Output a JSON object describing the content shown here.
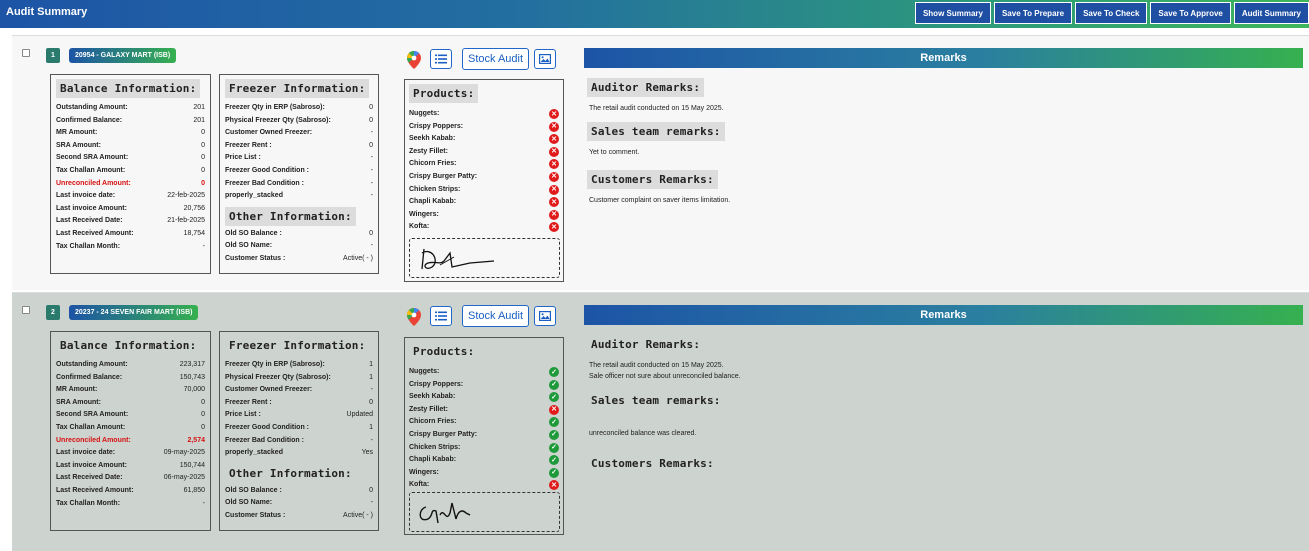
{
  "header": {
    "title": "Audit Summary",
    "buttons": [
      "Show Summary",
      "Save To Prepare",
      "Save To Check",
      "Save To Approve",
      "Audit Summary"
    ]
  },
  "labels": {
    "balance_info": "Balance Information:",
    "freezer_info": "Freezer Information:",
    "other_info": "Other Information:",
    "products": "Products:",
    "stock_audit": "Stock Audit",
    "remarks": "Remarks",
    "auditor_remarks": "Auditor Remarks:",
    "sales_remarks": "Sales team remarks:",
    "customer_remarks": "Customers Remarks:"
  },
  "colors": {
    "accent": "#1d54a6",
    "brand_green": "#36b04f",
    "danger": "#e01b1b",
    "ok": "#1f9a3a"
  },
  "cards": [
    {
      "index": "1",
      "shop": "20954 - GALAXY MART (ISB)",
      "balance": [
        {
          "k": "Outstanding Amount:",
          "v": "201"
        },
        {
          "k": "Confirmed Balance:",
          "v": "201"
        },
        {
          "k": "MR Amount:",
          "v": "0"
        },
        {
          "k": "SRA Amount:",
          "v": "0"
        },
        {
          "k": "Second SRA Amount:",
          "v": "0"
        },
        {
          "k": "Tax Challan Amount:",
          "v": "0"
        },
        {
          "k": "Unreconciled Amount:",
          "v": "0",
          "red": true
        },
        {
          "k": "Last invoice date:",
          "v": "22-feb-2025"
        },
        {
          "k": "Last invoice Amount:",
          "v": "20,756"
        },
        {
          "k": "Last Received Date:",
          "v": "21-feb-2025"
        },
        {
          "k": "Last Received Amount:",
          "v": "18,754"
        },
        {
          "k": "Tax Challan Month:",
          "v": "-"
        }
      ],
      "freezer": [
        {
          "k": "Freezer Qty in ERP (Sabroso):",
          "v": "0"
        },
        {
          "k": "Physical Freezer Qty (Sabroso):",
          "v": "0"
        },
        {
          "k": "Customer Owned Freezer:",
          "v": "-"
        },
        {
          "k": "Freezer Rent :",
          "v": "0"
        },
        {
          "k": "Price List :",
          "v": "-"
        },
        {
          "k": "Freezer Good Condition :",
          "v": "-"
        },
        {
          "k": "Freezer Bad Condition :",
          "v": "-"
        },
        {
          "k": "properly_stacked",
          "v": "-"
        }
      ],
      "other": [
        {
          "k": "Old SO Balance :",
          "v": "0"
        },
        {
          "k": "Old SO Name:",
          "v": "-"
        },
        {
          "k": "Customer Status :",
          "v": "Active( - )"
        }
      ],
      "products": [
        {
          "name": "Nuggets:",
          "ok": false
        },
        {
          "name": "Crispy Poppers:",
          "ok": false
        },
        {
          "name": "Seekh Kabab:",
          "ok": false
        },
        {
          "name": "Zesty Fillet:",
          "ok": false
        },
        {
          "name": "Chicorn Fries:",
          "ok": false
        },
        {
          "name": "Crispy Burger Patty:",
          "ok": false
        },
        {
          "name": "Chicken Strips:",
          "ok": false
        },
        {
          "name": "Chapli Kabab:",
          "ok": false
        },
        {
          "name": "Wingers:",
          "ok": false
        },
        {
          "name": "Kofta:",
          "ok": false
        }
      ],
      "auditor_remarks": [
        "The retail audit conducted on 15 May 2025."
      ],
      "sales_remarks": [
        "Yet to comment."
      ],
      "customer_remarks": [
        "Customer complaint on saver items limitation."
      ]
    },
    {
      "index": "2",
      "shop": "20237 - 24 SEVEN FAIR MART (ISB)",
      "balance": [
        {
          "k": "Outstanding Amount:",
          "v": "223,317"
        },
        {
          "k": "Confirmed Balance:",
          "v": "150,743"
        },
        {
          "k": "MR Amount:",
          "v": "70,000"
        },
        {
          "k": "SRA Amount:",
          "v": "0"
        },
        {
          "k": "Second SRA Amount:",
          "v": "0"
        },
        {
          "k": "Tax Challan Amount:",
          "v": "0"
        },
        {
          "k": "Unreconciled Amount:",
          "v": "2,574",
          "red": true
        },
        {
          "k": "Last invoice date:",
          "v": "09-may-2025"
        },
        {
          "k": "Last invoice Amount:",
          "v": "150,744"
        },
        {
          "k": "Last Received Date:",
          "v": "06-may-2025"
        },
        {
          "k": "Last Received Amount:",
          "v": "61,850"
        },
        {
          "k": "Tax Challan Month:",
          "v": "-"
        }
      ],
      "freezer": [
        {
          "k": "Freezer Qty in ERP (Sabroso):",
          "v": "1"
        },
        {
          "k": "Physical Freezer Qty (Sabroso):",
          "v": "1"
        },
        {
          "k": "Customer Owned Freezer:",
          "v": "-"
        },
        {
          "k": "Freezer Rent :",
          "v": "0"
        },
        {
          "k": "Price List :",
          "v": "Updated"
        },
        {
          "k": "Freezer Good Condition :",
          "v": "1"
        },
        {
          "k": "Freezer Bad Condition :",
          "v": "-"
        },
        {
          "k": "properly_stacked",
          "v": "Yes"
        }
      ],
      "other": [
        {
          "k": "Old SO Balance :",
          "v": "0"
        },
        {
          "k": "Old SO Name:",
          "v": "-"
        },
        {
          "k": "Customer Status :",
          "v": "Active( - )"
        }
      ],
      "products": [
        {
          "name": "Nuggets:",
          "ok": true
        },
        {
          "name": "Crispy Poppers:",
          "ok": true
        },
        {
          "name": "Seekh Kabab:",
          "ok": true
        },
        {
          "name": "Zesty Fillet:",
          "ok": false
        },
        {
          "name": "Chicorn Fries:",
          "ok": true
        },
        {
          "name": "Crispy Burger Patty:",
          "ok": true
        },
        {
          "name": "Chicken Strips:",
          "ok": true
        },
        {
          "name": "Chapli Kabab:",
          "ok": true
        },
        {
          "name": "Wingers:",
          "ok": true
        },
        {
          "name": "Kofta:",
          "ok": false
        }
      ],
      "auditor_remarks": [
        "The retail audit conducted on 15 May 2025.",
        "Sale officer not sure about unreconciled balance."
      ],
      "sales_remarks": [
        "unreconciled balance was cleared."
      ],
      "customer_remarks": []
    }
  ]
}
